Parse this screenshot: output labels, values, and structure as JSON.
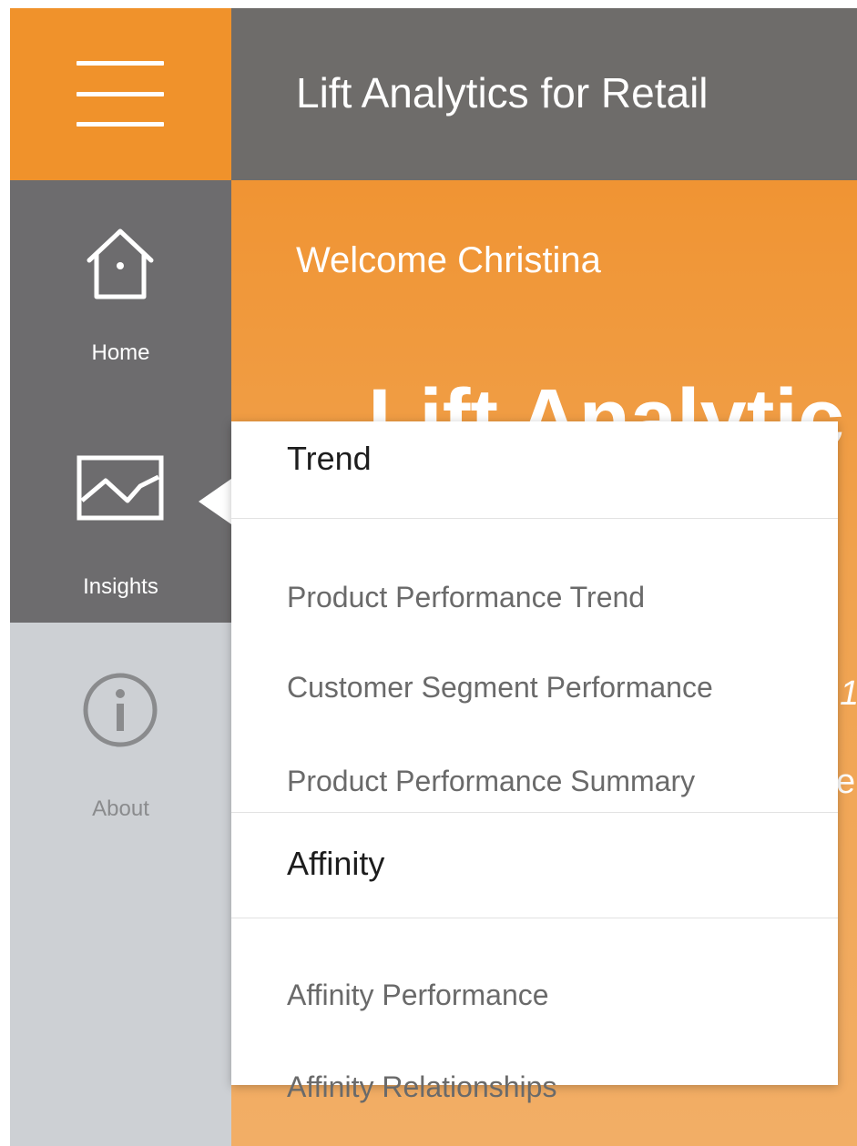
{
  "header": {
    "title": "Lift Analytics for Retail"
  },
  "welcome": {
    "greeting": "Welcome Christina",
    "heading": "Lift Analytic"
  },
  "sidebar": {
    "items": [
      {
        "label": "Home",
        "icon": "home-icon"
      },
      {
        "label": "Insights",
        "icon": "chart-icon"
      },
      {
        "label": "About",
        "icon": "info-icon"
      }
    ]
  },
  "popup": {
    "sections": [
      {
        "title": "Trend",
        "items": [
          "Product Performance Trend",
          "Customer Segment Performance",
          "Product Performance Summary"
        ]
      },
      {
        "title": "Affinity",
        "items": [
          "Affinity Performance",
          "Affinity Relationships"
        ]
      }
    ]
  },
  "colors": {
    "accent": "#f0922b",
    "rail_dark": "#6d6c6e",
    "header": "#6e6c6a",
    "rail_light": "#cdd0d4"
  }
}
